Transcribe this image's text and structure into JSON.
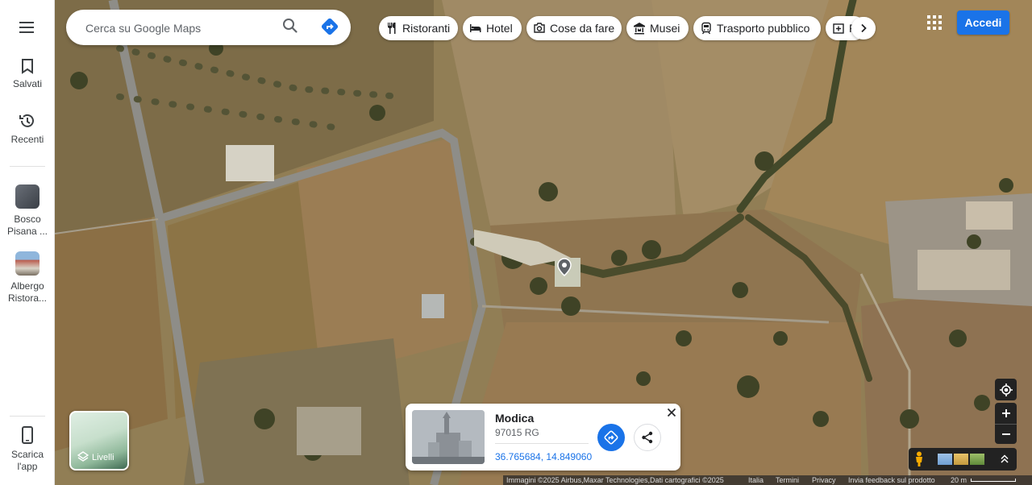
{
  "search": {
    "placeholder": "Cerca su Google Maps"
  },
  "chips": [
    {
      "label": "Ristoranti",
      "icon": "fork-knife-icon"
    },
    {
      "label": "Hotel",
      "icon": "bed-icon"
    },
    {
      "label": "Cose da fare",
      "icon": "camera-icon"
    },
    {
      "label": "Musei",
      "icon": "museum-icon"
    },
    {
      "label": "Trasporto pubblico",
      "icon": "train-icon"
    },
    {
      "label": "Farmacie",
      "icon": "pharmacy-icon"
    }
  ],
  "rail": {
    "saved": "Salvati",
    "recents": "Recenti",
    "recent_items": [
      {
        "label1": "Bosco",
        "label2": "Pisana ..."
      },
      {
        "label1": "Albergo",
        "label2": "Ristora..."
      }
    ],
    "download": {
      "line1": "Scarica",
      "line2": "l'app"
    }
  },
  "signin": "Accedi",
  "layers": "Livelli",
  "place_card": {
    "title": "Modica",
    "subtitle": "97015 RG",
    "coords": "36.765684, 14.849060"
  },
  "attribution": {
    "imagery": "Immagini ©2025 Airbus,Maxar Technologies,Dati cartografici ©2025",
    "country": "Italia",
    "terms": "Termini",
    "privacy": "Privacy",
    "feedback": "Invia feedback sul prodotto",
    "scale": "20 m"
  },
  "colors": {
    "accent": "#1a73e8",
    "control_bg": "#222222"
  }
}
